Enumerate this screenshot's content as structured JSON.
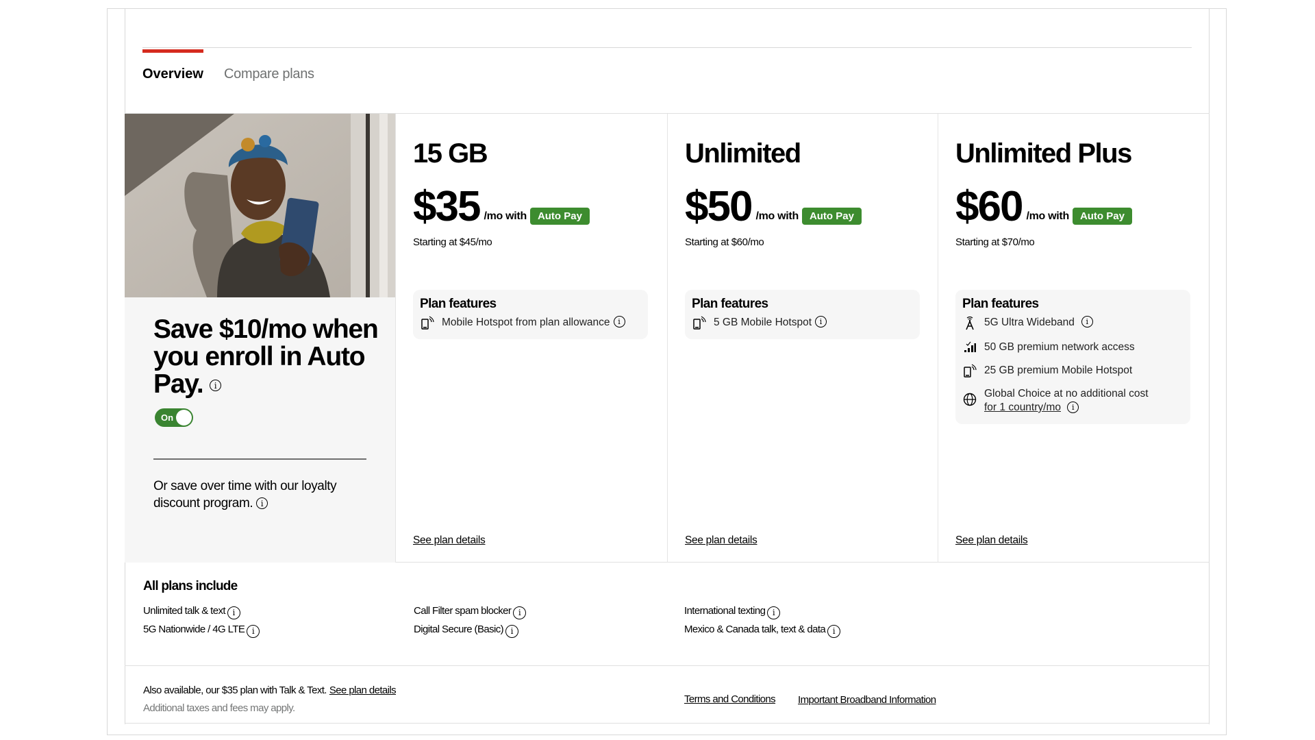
{
  "tabs": [
    {
      "label": "Overview",
      "active": true
    },
    {
      "label": "Compare plans",
      "active": false
    }
  ],
  "accent_color": "#d52b1e",
  "autopay_color": "#3d8c2f",
  "promo": {
    "image_alt": "Smiling woman in head wrap taking a selfie with a phone",
    "title": "Save $10/mo when you enroll in Auto Pay.",
    "toggle_label": "On",
    "toggle_state": "on",
    "subtext": "Or save over time with our loyalty discount program."
  },
  "plans": [
    {
      "name": "15 GB",
      "price": "$35",
      "per": "/mo with",
      "badge": "Auto Pay",
      "starting": "Starting at $45/mo",
      "features_title": "Plan features",
      "features": [
        {
          "icon": "mobile-hotspot-icon",
          "text": "Mobile Hotspot from plan allowance",
          "info": true
        }
      ],
      "details_link": "See plan details"
    },
    {
      "name": "Unlimited",
      "price": "$50",
      "per": "/mo with",
      "badge": "Auto Pay",
      "starting": "Starting at $60/mo",
      "features_title": "Plan features",
      "features": [
        {
          "icon": "mobile-hotspot-icon",
          "text": "5 GB Mobile Hotspot",
          "info": true
        }
      ],
      "details_link": "See plan details"
    },
    {
      "name": "Unlimited Plus",
      "price": "$60",
      "per": "/mo with",
      "badge": "Auto Pay",
      "starting": "Starting at $70/mo",
      "features_title": "Plan features",
      "features": [
        {
          "icon": "5g-tower-icon",
          "text": "5G Ultra Wideband",
          "info": true
        },
        {
          "icon": "signal-bars-icon",
          "text": "50 GB premium network access",
          "info": false
        },
        {
          "icon": "mobile-hotspot-icon",
          "text": "25 GB premium Mobile Hotspot",
          "info": false
        },
        {
          "icon": "globe-icon",
          "text": "Global Choice at no additional cost",
          "link": "for 1 country/mo",
          "info": true
        }
      ],
      "details_link": "See plan details"
    }
  ],
  "all_plans": {
    "title": "All plans include",
    "items": [
      "Unlimited talk & text",
      "5G Nationwide / 4G LTE",
      "Call Filter spam blocker",
      "Digital Secure (Basic)",
      "International texting",
      "Mexico & Canada talk, text & data"
    ]
  },
  "footer": {
    "also_available": "Also available, our $35 plan with Talk & Text.",
    "also_link": "See plan details",
    "note": "Additional taxes and fees may apply.",
    "terms": "Terms and Conditions",
    "broadband": "Important Broadband Information"
  }
}
